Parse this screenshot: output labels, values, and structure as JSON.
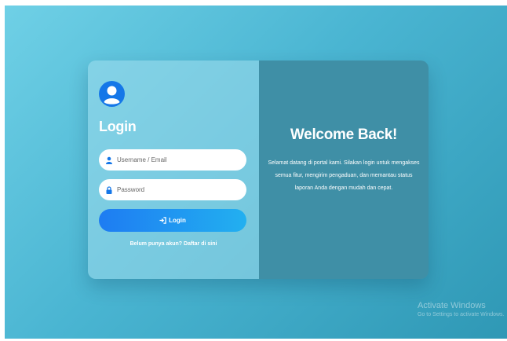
{
  "login_panel": {
    "title": "Login",
    "username_placeholder": "Username / Email",
    "password_placeholder": "Password",
    "login_button_label": "Login",
    "register_prompt": "Belum punya akun?",
    "register_link": "Daftar di sini"
  },
  "welcome_panel": {
    "title": "Welcome Back!",
    "text": "Selamat datang di portal kami. Silakan login untuk mengakses semua fitur, mengirim pengaduan, dan memantau status laporan Anda dengan mudah dan cepat."
  },
  "windows_watermark": {
    "title": "Activate Windows",
    "subtitle": "Go to Settings to activate Windows."
  },
  "icons": {
    "avatar": "user-circle-icon",
    "username": "user-icon",
    "password": "lock-icon",
    "login_button": "sign-in-icon"
  },
  "colors": {
    "accent": "#1e7cf2",
    "accent_end": "#22b0f0",
    "welcome_panel_bg": "#3f8fa6",
    "background_start": "#6fd0e6",
    "background_end": "#2f98b5"
  }
}
